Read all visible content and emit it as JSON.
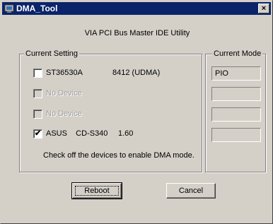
{
  "window": {
    "title": "DMA_Tool",
    "close_glyph": "×"
  },
  "header": {
    "subtitle": "VIA PCI Bus Master IDE Utility"
  },
  "current_setting": {
    "legend": "Current Setting",
    "devices": [
      {
        "name": "ST36530A",
        "info": "8412 (UDMA)",
        "checked": false,
        "enabled": true
      },
      {
        "name": "No Device",
        "info": "",
        "checked": false,
        "enabled": false
      },
      {
        "name": "No Device",
        "info": "",
        "checked": false,
        "enabled": false
      },
      {
        "name": "ASUS    CD-S340",
        "info": "1.60",
        "checked": true,
        "enabled": true
      }
    ],
    "hint": "Check off the devices to enable DMA mode."
  },
  "current_mode": {
    "legend": "Current Mode",
    "modes": [
      "PIO",
      "",
      "",
      ""
    ]
  },
  "buttons": {
    "reboot": "Reboot",
    "cancel": "Cancel"
  },
  "check_glyph": "✔",
  "colors": {
    "titlebar": "#0a246a",
    "face": "#d4d0c8"
  }
}
